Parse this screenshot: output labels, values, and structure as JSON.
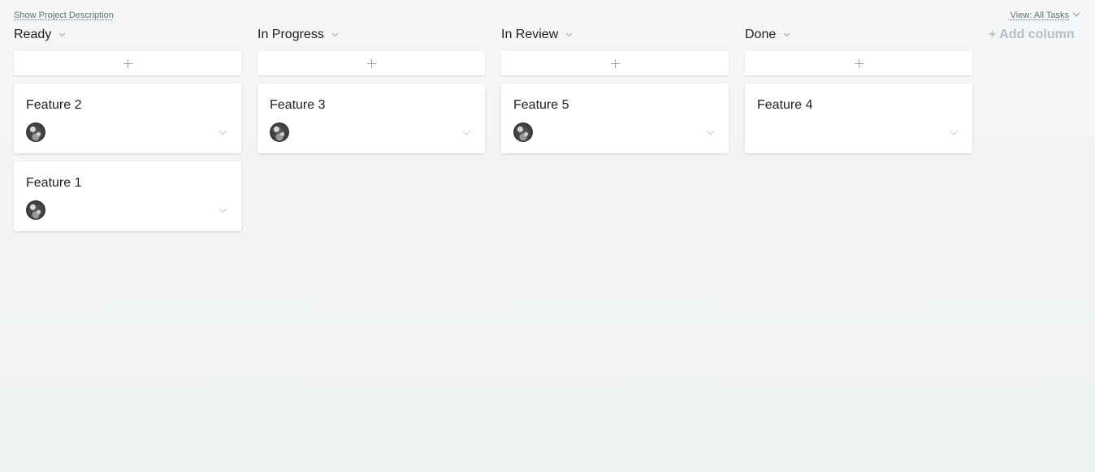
{
  "topbar": {
    "show_description": "Show Project Description",
    "view_label": "View: All Tasks"
  },
  "columns": [
    {
      "title": "Ready",
      "cards": [
        {
          "title": "Feature 2",
          "has_assignee": true
        },
        {
          "title": "Feature 1",
          "has_assignee": true
        }
      ]
    },
    {
      "title": "In Progress",
      "cards": [
        {
          "title": "Feature 3",
          "has_assignee": true
        }
      ]
    },
    {
      "title": "In Review",
      "cards": [
        {
          "title": "Feature 5",
          "has_assignee": true
        }
      ]
    },
    {
      "title": "Done",
      "cards": [
        {
          "title": "Feature 4",
          "has_assignee": false
        }
      ]
    }
  ],
  "add_column_label": "+ Add column",
  "icons": {
    "add_task": "plus-icon",
    "column_menu": "chevron-down-icon",
    "card_menu": "chevron-down-icon",
    "assignee": "avatar"
  },
  "colors": {
    "background": "#f3f5f6",
    "card": "#ffffff",
    "muted_text": "#646f79",
    "add_column": "#b7bec4"
  }
}
